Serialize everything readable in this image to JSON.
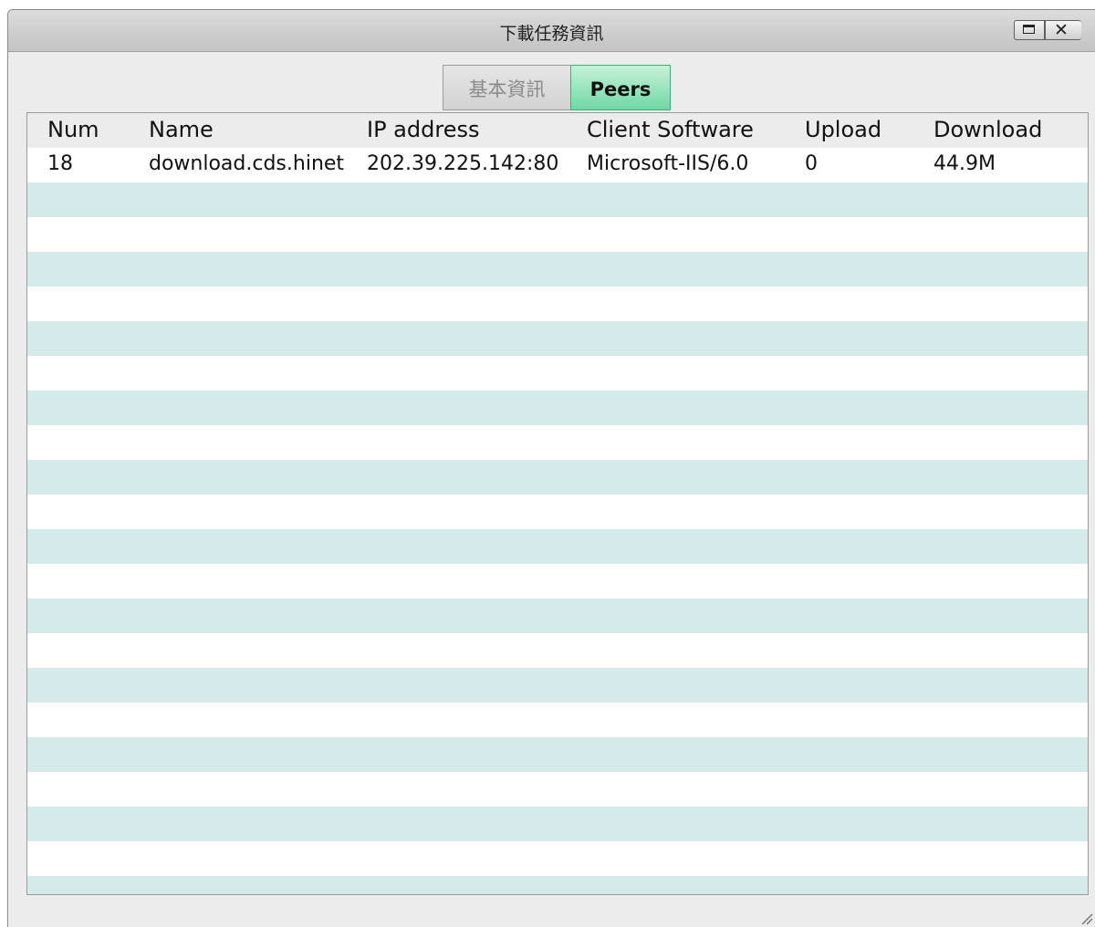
{
  "window": {
    "title": "下載任務資訊",
    "maximize_icon": "maximize-icon",
    "close_icon": "close-icon"
  },
  "tabs": [
    {
      "label": "基本資訊",
      "active": false
    },
    {
      "label": "Peers",
      "active": true
    }
  ],
  "table": {
    "columns": [
      "Num",
      "Name",
      "IP address",
      "Client Software",
      "Upload",
      "Download"
    ],
    "rows": [
      [
        "18",
        "download.cds.hinet",
        "202.39.225.142:80",
        "Microsoft-IIS/6.0",
        "0",
        "44.9M"
      ]
    ]
  },
  "colors": {
    "active_tab": "#6fd8a4",
    "stripe": "#d5eaea",
    "header_bg": "#ececec"
  }
}
